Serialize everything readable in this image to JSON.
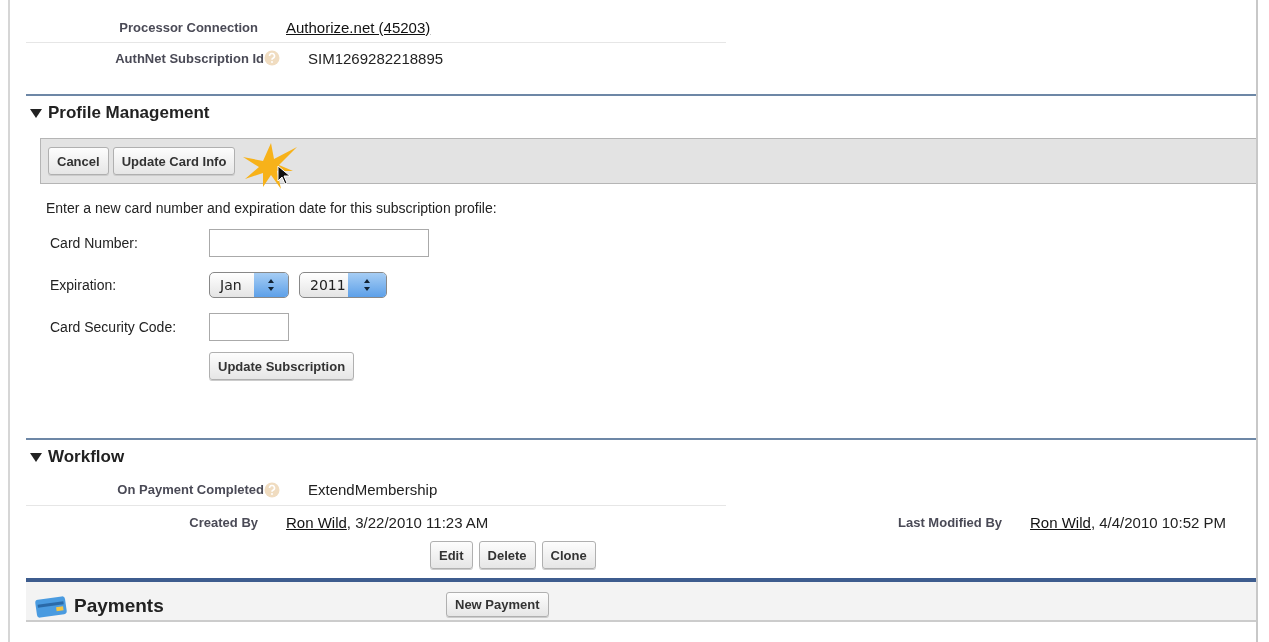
{
  "detail_rows": [
    {
      "label": "Processor Connection",
      "help": false,
      "kind": "link",
      "value": "Authorize.net (45203)"
    },
    {
      "label": "AuthNet Subscription Id",
      "help": true,
      "kind": "text",
      "value": "SIM1269282218895"
    }
  ],
  "profile_management": {
    "title": "Profile Management",
    "expanded": true,
    "toolbar_buttons": [
      "Cancel",
      "Update Card Info"
    ],
    "instructions": "Enter a new card number and expiration date for this subscription profile:",
    "fields": [
      {
        "kind": "input",
        "label": "Card Number:"
      },
      {
        "kind": "selects",
        "label": "Expiration:",
        "options": [
          "Jan",
          "2011"
        ]
      },
      {
        "kind": "input",
        "label": "Card Security Code:"
      }
    ],
    "submit": "Update Subscription"
  },
  "workflow": {
    "title": "Workflow",
    "expanded": true,
    "rows": [
      {
        "label": "On Payment Completed",
        "help": true,
        "kind": "text",
        "value": "ExtendMembership"
      }
    ],
    "created_by": {
      "label": "Created By",
      "user": "Ron Wild",
      "stamp": ", 3/22/2010 11:23 AM"
    },
    "last_modified_by": {
      "label": "Last Modified By",
      "user": "Ron Wild",
      "stamp": ", 4/4/2010 10:52 PM"
    },
    "buttons": [
      "Edit",
      "Delete",
      "Clone"
    ]
  },
  "payments": {
    "title": "Payments",
    "button": "New Payment"
  }
}
